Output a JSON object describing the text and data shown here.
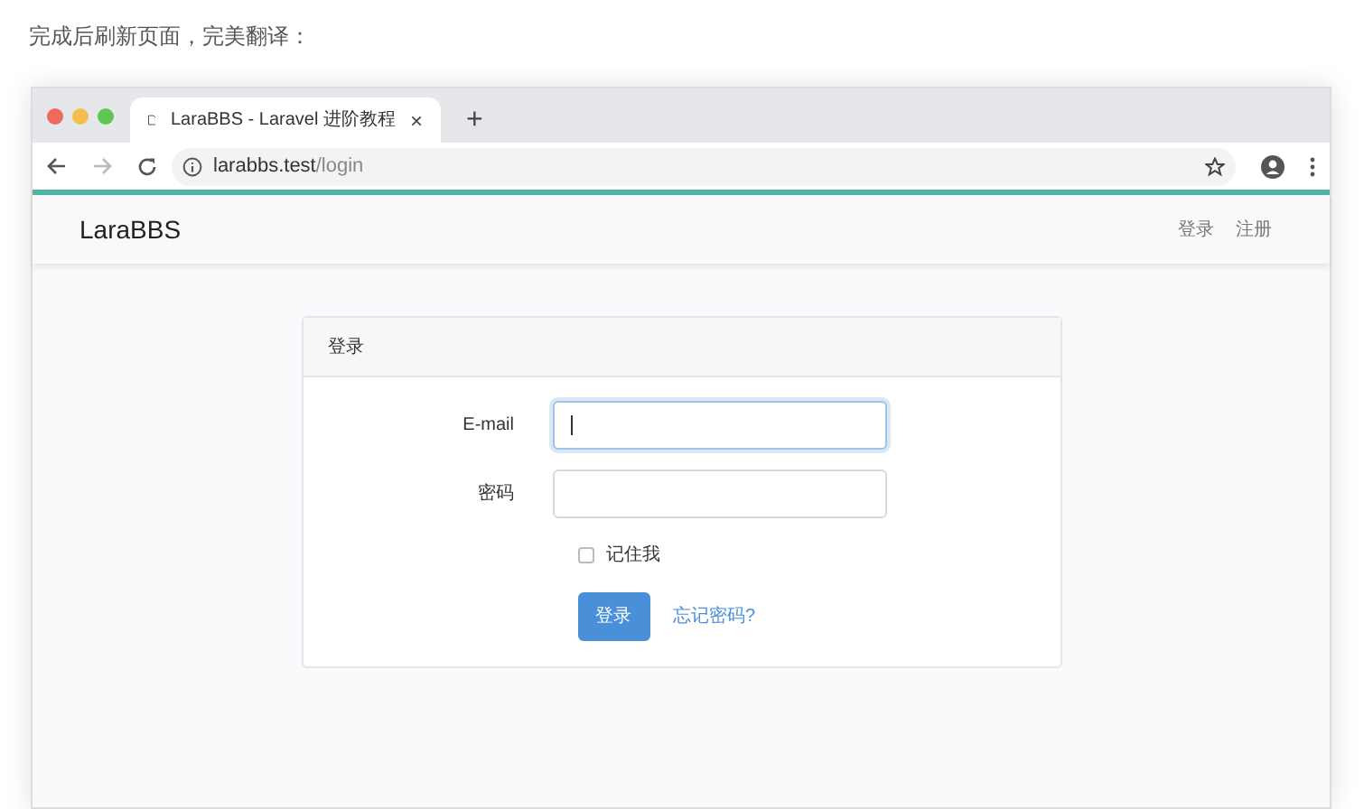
{
  "caption": "完成后刷新页面，完美翻译：",
  "browser": {
    "tab": {
      "title": "LaraBBS - Laravel 进阶教程",
      "close": "×"
    },
    "new_tab": "+",
    "address": {
      "host": "larabbs.test",
      "path": "/login"
    }
  },
  "navbar": {
    "brand": "LaraBBS",
    "links": [
      {
        "label": "登录"
      },
      {
        "label": "注册"
      }
    ]
  },
  "card": {
    "title": "登录",
    "fields": [
      {
        "label": "E-mail",
        "focused": true
      },
      {
        "label": "密码",
        "focused": false
      }
    ],
    "remember": {
      "label": "记住我",
      "checked": false
    },
    "submit": "登录",
    "forgot": "忘记密码?"
  }
}
